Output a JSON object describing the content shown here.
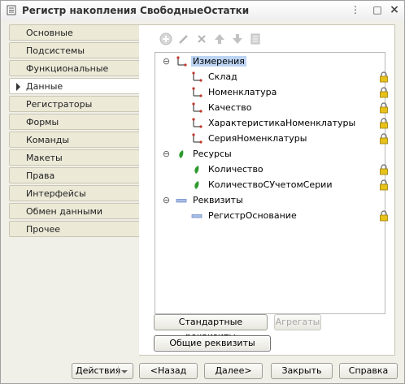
{
  "window": {
    "title": "Регистр накопления СвободныеОстатки",
    "controls": [
      "⋮",
      "□",
      "×"
    ]
  },
  "sidebar": {
    "items": [
      {
        "label": "Основные",
        "active": false
      },
      {
        "label": "Подсистемы",
        "active": false
      },
      {
        "label": "Функциональные опции",
        "active": false
      },
      {
        "label": "Данные",
        "active": true
      },
      {
        "label": "Регистраторы",
        "active": false
      },
      {
        "label": "Формы",
        "active": false
      },
      {
        "label": "Команды",
        "active": false
      },
      {
        "label": "Макеты",
        "active": false
      },
      {
        "label": "Права",
        "active": false
      },
      {
        "label": "Интерфейсы",
        "active": false
      },
      {
        "label": "Обмен данными",
        "active": false
      },
      {
        "label": "Прочее",
        "active": false
      }
    ]
  },
  "toolbar": {
    "icons": [
      "add-icon",
      "edit-icon",
      "delete-icon",
      "move-up-icon",
      "move-down-icon",
      "list-icon"
    ]
  },
  "tree": {
    "groups": [
      {
        "label": "Измерения",
        "icon": "dimension-icon",
        "expanded": true,
        "selected": true,
        "items": [
          "Склад",
          "Номенклатура",
          "Качество",
          "ХарактеристикаНоменклатуры",
          "СерияНоменклатуры"
        ]
      },
      {
        "label": "Ресурсы",
        "icon": "resource-icon",
        "expanded": true,
        "selected": false,
        "items": [
          "Количество",
          "КоличествоСУчетомСерии"
        ]
      },
      {
        "label": "Реквизиты",
        "icon": "attribute-icon",
        "expanded": true,
        "selected": false,
        "items": [
          "РегистрОснование"
        ]
      }
    ]
  },
  "buttons": {
    "standard_attributes": "Стандартные реквизиты",
    "aggregates": "Агрегаты",
    "common_attributes": "Общие реквизиты",
    "actions": "Действия",
    "back": "<Назад",
    "next": "Далее>",
    "close": "Закрыть",
    "help": "Справка"
  },
  "colors": {
    "selection": "#bcd4f2",
    "dimension_red": "#c0392b",
    "resource_green": "#2e9a2e",
    "attribute_blue": "#6f8fc6",
    "lock_yellow": "#e8c21a"
  }
}
